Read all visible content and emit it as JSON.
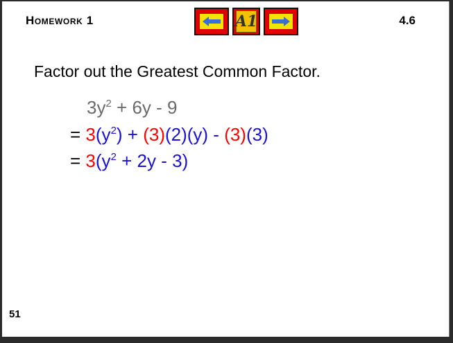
{
  "header": {
    "title": "Homework 1",
    "section": "4.6",
    "nav": {
      "home_label": "A1",
      "colors": {
        "button_bg": "#e30000",
        "icon_bg": "#f5e400",
        "arrow": "#3a6fd8"
      }
    }
  },
  "content": {
    "prompt": "Factor out the Greatest Common Factor.",
    "line1": {
      "a": "3y",
      "exp": "2",
      "b": " + 6y - 9"
    },
    "line2": {
      "eq": "= ",
      "p1": "3",
      "p2": "(y",
      "exp": "2",
      "p3": ") + ",
      "p4": "(3)",
      "p5": "(2)(y) - ",
      "p6": "(3)",
      "p7": "(3)"
    },
    "line3": {
      "eq": "= ",
      "p1": "3",
      "p2": "(y",
      "exp": "2",
      "p3": " + 2y - 3)"
    },
    "colors": {
      "gcf": "#ff0000",
      "remaining": "#1a10d8",
      "original": "#6a6a6a"
    }
  },
  "footer": {
    "page_number": "51"
  }
}
